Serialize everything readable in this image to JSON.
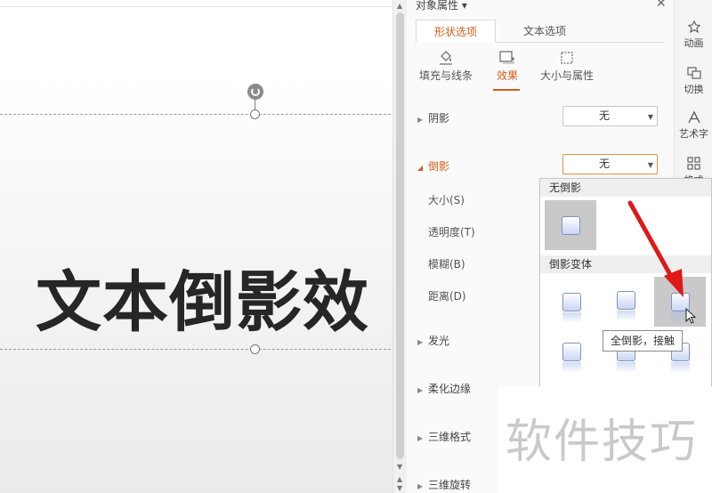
{
  "slide": {
    "text": "文本倒影效"
  },
  "panel": {
    "title": "对象属性 ▾",
    "close_glyph": "✕",
    "tabs": [
      {
        "label": "形状选项",
        "active": true
      },
      {
        "label": "文本选项",
        "active": false
      }
    ],
    "subtabs": [
      {
        "label": "填充与线条",
        "icon": "paint-bucket-icon"
      },
      {
        "label": "效果",
        "icon": "effects-icon",
        "active": true
      },
      {
        "label": "大小与属性",
        "icon": "size-icon"
      }
    ],
    "sections": {
      "shadow": {
        "label": "阴影",
        "value": "无"
      },
      "reflection": {
        "label": "倒影",
        "value": "无",
        "expanded": true
      },
      "reflection_props": [
        "大小(S)",
        "透明度(T)",
        "模糊(B)",
        "距离(D)"
      ],
      "glow": "发光",
      "soft_edges": "柔化边缘",
      "format_3d": "三维格式",
      "rotation_3d": "三维旋转"
    }
  },
  "rightbar": [
    {
      "label": "动画",
      "icon": "animation-icon"
    },
    {
      "label": "切换",
      "icon": "transition-icon"
    },
    {
      "label": "艺术字",
      "icon": "wordart-icon"
    },
    {
      "label": "格式",
      "icon": "grid-icon"
    }
  ],
  "dropdown": {
    "header_none": "无倒影",
    "header_variants": "倒影变体",
    "tooltip": "全倒影，接触"
  },
  "watermark": "软件技巧",
  "colors": {
    "accent": "#d55d1b",
    "arrow": "#e01818"
  }
}
